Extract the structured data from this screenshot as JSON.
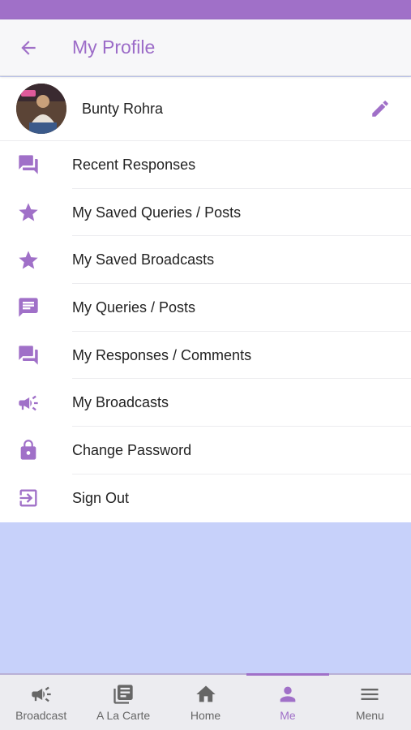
{
  "colors": {
    "accent": "#a070c8",
    "background": "#c7d1fa",
    "tab_inactive": "#666666"
  },
  "header": {
    "title": "My Profile",
    "back_icon": "arrow-left-icon"
  },
  "profile": {
    "name": "Bunty Rohra",
    "edit_icon": "pencil-icon"
  },
  "menu": [
    {
      "label": "Recent Responses",
      "icon": "chat-bubbles-icon"
    },
    {
      "label": "My Saved Queries / Posts",
      "icon": "star-icon"
    },
    {
      "label": "My Saved Broadcasts",
      "icon": "star-icon"
    },
    {
      "label": "My Queries / Posts",
      "icon": "message-icon"
    },
    {
      "label": "My Responses / Comments",
      "icon": "chat-bubbles-icon"
    },
    {
      "label": "My Broadcasts",
      "icon": "megaphone-icon"
    },
    {
      "label": "Change Password",
      "icon": "lock-icon"
    },
    {
      "label": "Sign Out",
      "icon": "sign-out-icon"
    }
  ],
  "tabs": [
    {
      "label": "Broadcast",
      "icon": "megaphone-icon"
    },
    {
      "label": "A La Carte",
      "icon": "newspaper-icon"
    },
    {
      "label": "Home",
      "icon": "home-icon"
    },
    {
      "label": "Me",
      "icon": "person-icon",
      "active": true
    },
    {
      "label": "Menu",
      "icon": "hamburger-menu-icon"
    }
  ]
}
